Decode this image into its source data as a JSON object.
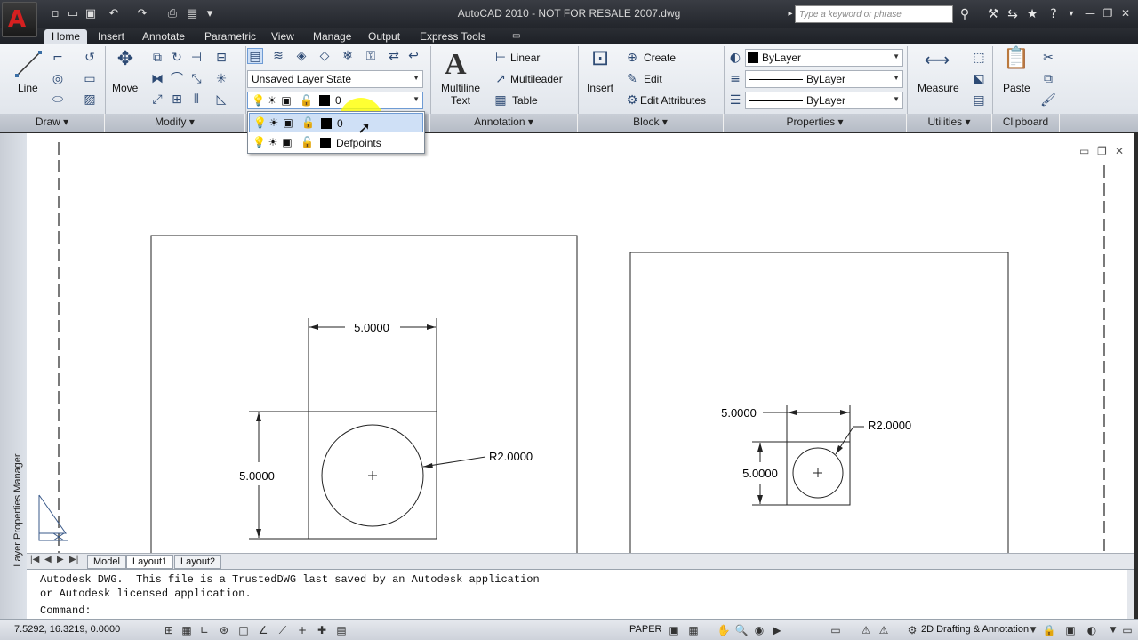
{
  "title_bar": {
    "app_letter": "A",
    "title": "AutoCAD 2010 - NOT FOR RESALE    2007.dwg",
    "search_placeholder": "Type a keyword or phrase"
  },
  "ribbon_tabs": [
    "Home",
    "Insert",
    "Annotate",
    "Parametric",
    "View",
    "Manage",
    "Output",
    "Express Tools"
  ],
  "active_tab": "Home",
  "panels": {
    "draw": {
      "title": "Draw",
      "line_label": "Line"
    },
    "modify": {
      "title": "Modify",
      "move_label": "Move"
    },
    "layers": {
      "layer_state": "Unsaved Layer State",
      "current_layer": "0",
      "dropdown_items": [
        "0",
        "Defpoints"
      ]
    },
    "annotation": {
      "title": "Annotation",
      "multiline_text": "Multiline Text",
      "linear": "Linear",
      "multileader": "Multileader",
      "table": "Table"
    },
    "block": {
      "title": "Block",
      "insert": "Insert",
      "create": "Create",
      "edit": "Edit",
      "edit_attributes": "Edit Attributes"
    },
    "properties": {
      "title": "Properties",
      "color": "ByLayer",
      "linetype": "ByLayer",
      "lineweight": "ByLayer"
    },
    "utilities": {
      "title": "Utilities",
      "measure": "Measure"
    },
    "clipboard": {
      "title": "Clipboard",
      "paste": "Paste"
    }
  },
  "drawing": {
    "left_view": {
      "width_dim": "5.0000",
      "height_dim": "5.0000",
      "radius_dim": "R2.0000"
    },
    "right_view": {
      "width_dim": "5.0000",
      "height_dim": "5.0000",
      "radius_dim": "R2.0000"
    }
  },
  "side_palette_label": "Layer Properties Manager",
  "layout_tabs": [
    "Model",
    "Layout1",
    "Layout2"
  ],
  "active_layout": "Layout1",
  "command_lines": [
    "Autodesk DWG.  This file is a TrustedDWG last saved by an Autodesk application",
    "or Autodesk licensed application.",
    "Command:"
  ],
  "status": {
    "coords": "7.5292, 16.3219, 0.0000",
    "space": "PAPER",
    "workspace": "2D Drafting & Annotation"
  },
  "colors": {
    "accent": "#d62020",
    "ribbon_bg": "#e6e9ee",
    "highlight": "#ffff00"
  }
}
